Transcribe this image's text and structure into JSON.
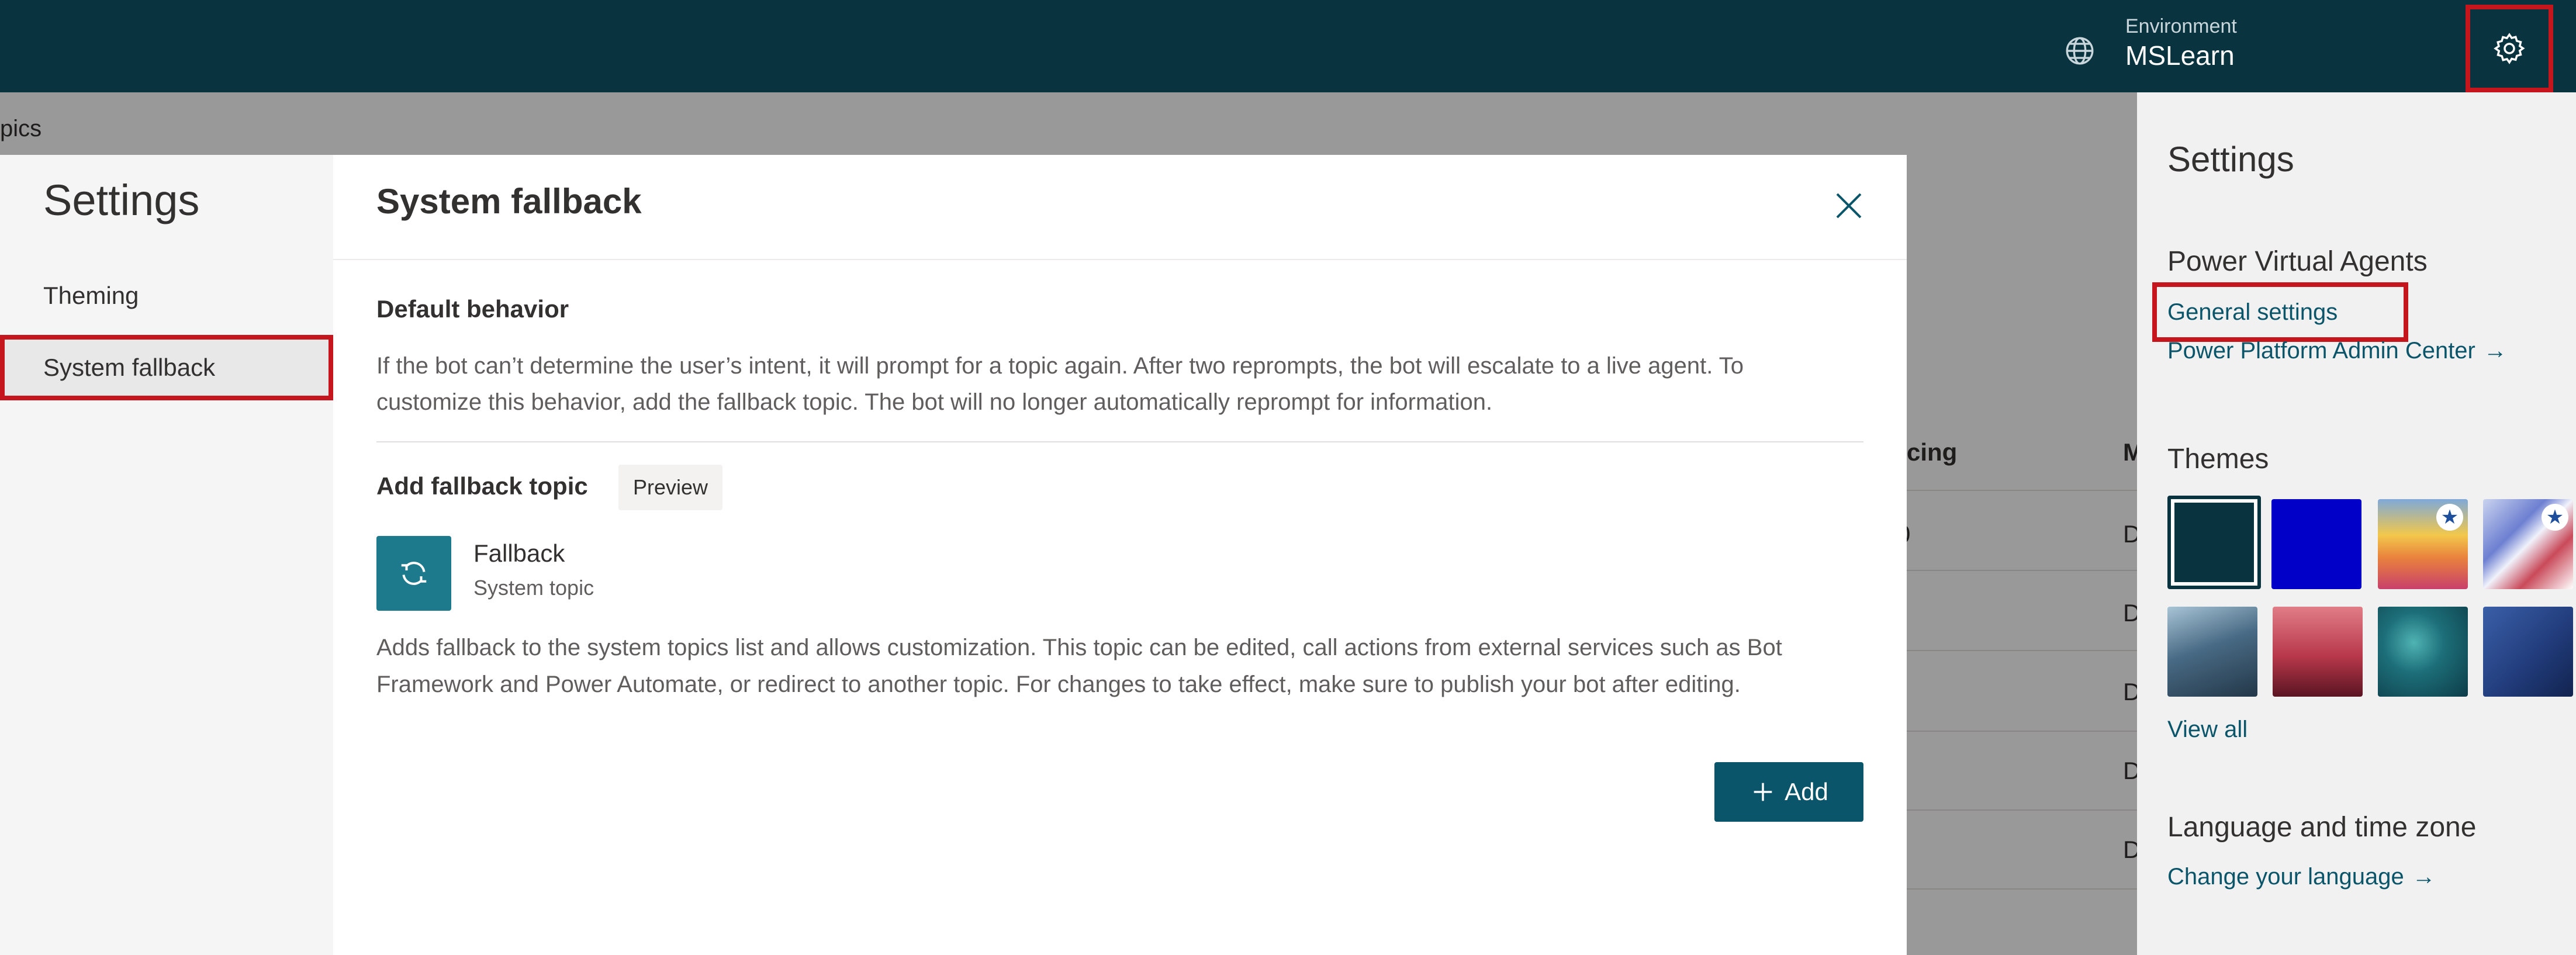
{
  "topbar": {
    "environment_label": "Environment",
    "environment_name": "MSLearn",
    "background_color": "#08333f",
    "icons": [
      "globe-icon",
      "gear-icon"
    ]
  },
  "background_page": {
    "breadcrumb": "pics",
    "column_a": "cing",
    "column_b": "M",
    "row_prefix": "D",
    "row_zero": "0"
  },
  "settings_nav": {
    "title": "Settings",
    "items": [
      {
        "label": "Theming"
      },
      {
        "label": "System fallback",
        "selected": true
      }
    ]
  },
  "dialog": {
    "title": "System fallback",
    "default_behavior": {
      "heading": "Default behavior",
      "text": "If the bot can’t determine the user’s intent, it will prompt for a topic again. After two reprompts, the bot will escalate to a live agent. To customize this behavior, add the fallback topic. The bot will no longer automatically reprompt for information."
    },
    "add_fallback": {
      "heading": "Add fallback topic",
      "badge": "Preview",
      "topic_name": "Fallback",
      "topic_type": "System topic",
      "description": "Adds fallback to the system topics list and allows customization. This topic can be edited, call actions from external services such as Bot Framework and Power Automate, or redirect to another topic. For changes to take effect, make sure to publish your bot after editing.",
      "add_label": "Add"
    },
    "accent_color": "#0b556a"
  },
  "settings_panel": {
    "title": "Settings",
    "pva_heading": "Power Virtual Agents",
    "general_settings": "General settings",
    "admin_center": "Power Platform Admin Center",
    "themes_heading": "Themes",
    "view_all": "View all",
    "language_heading": "Language and time zone",
    "change_language": "Change your language"
  },
  "highlight_color": "#c4161c"
}
